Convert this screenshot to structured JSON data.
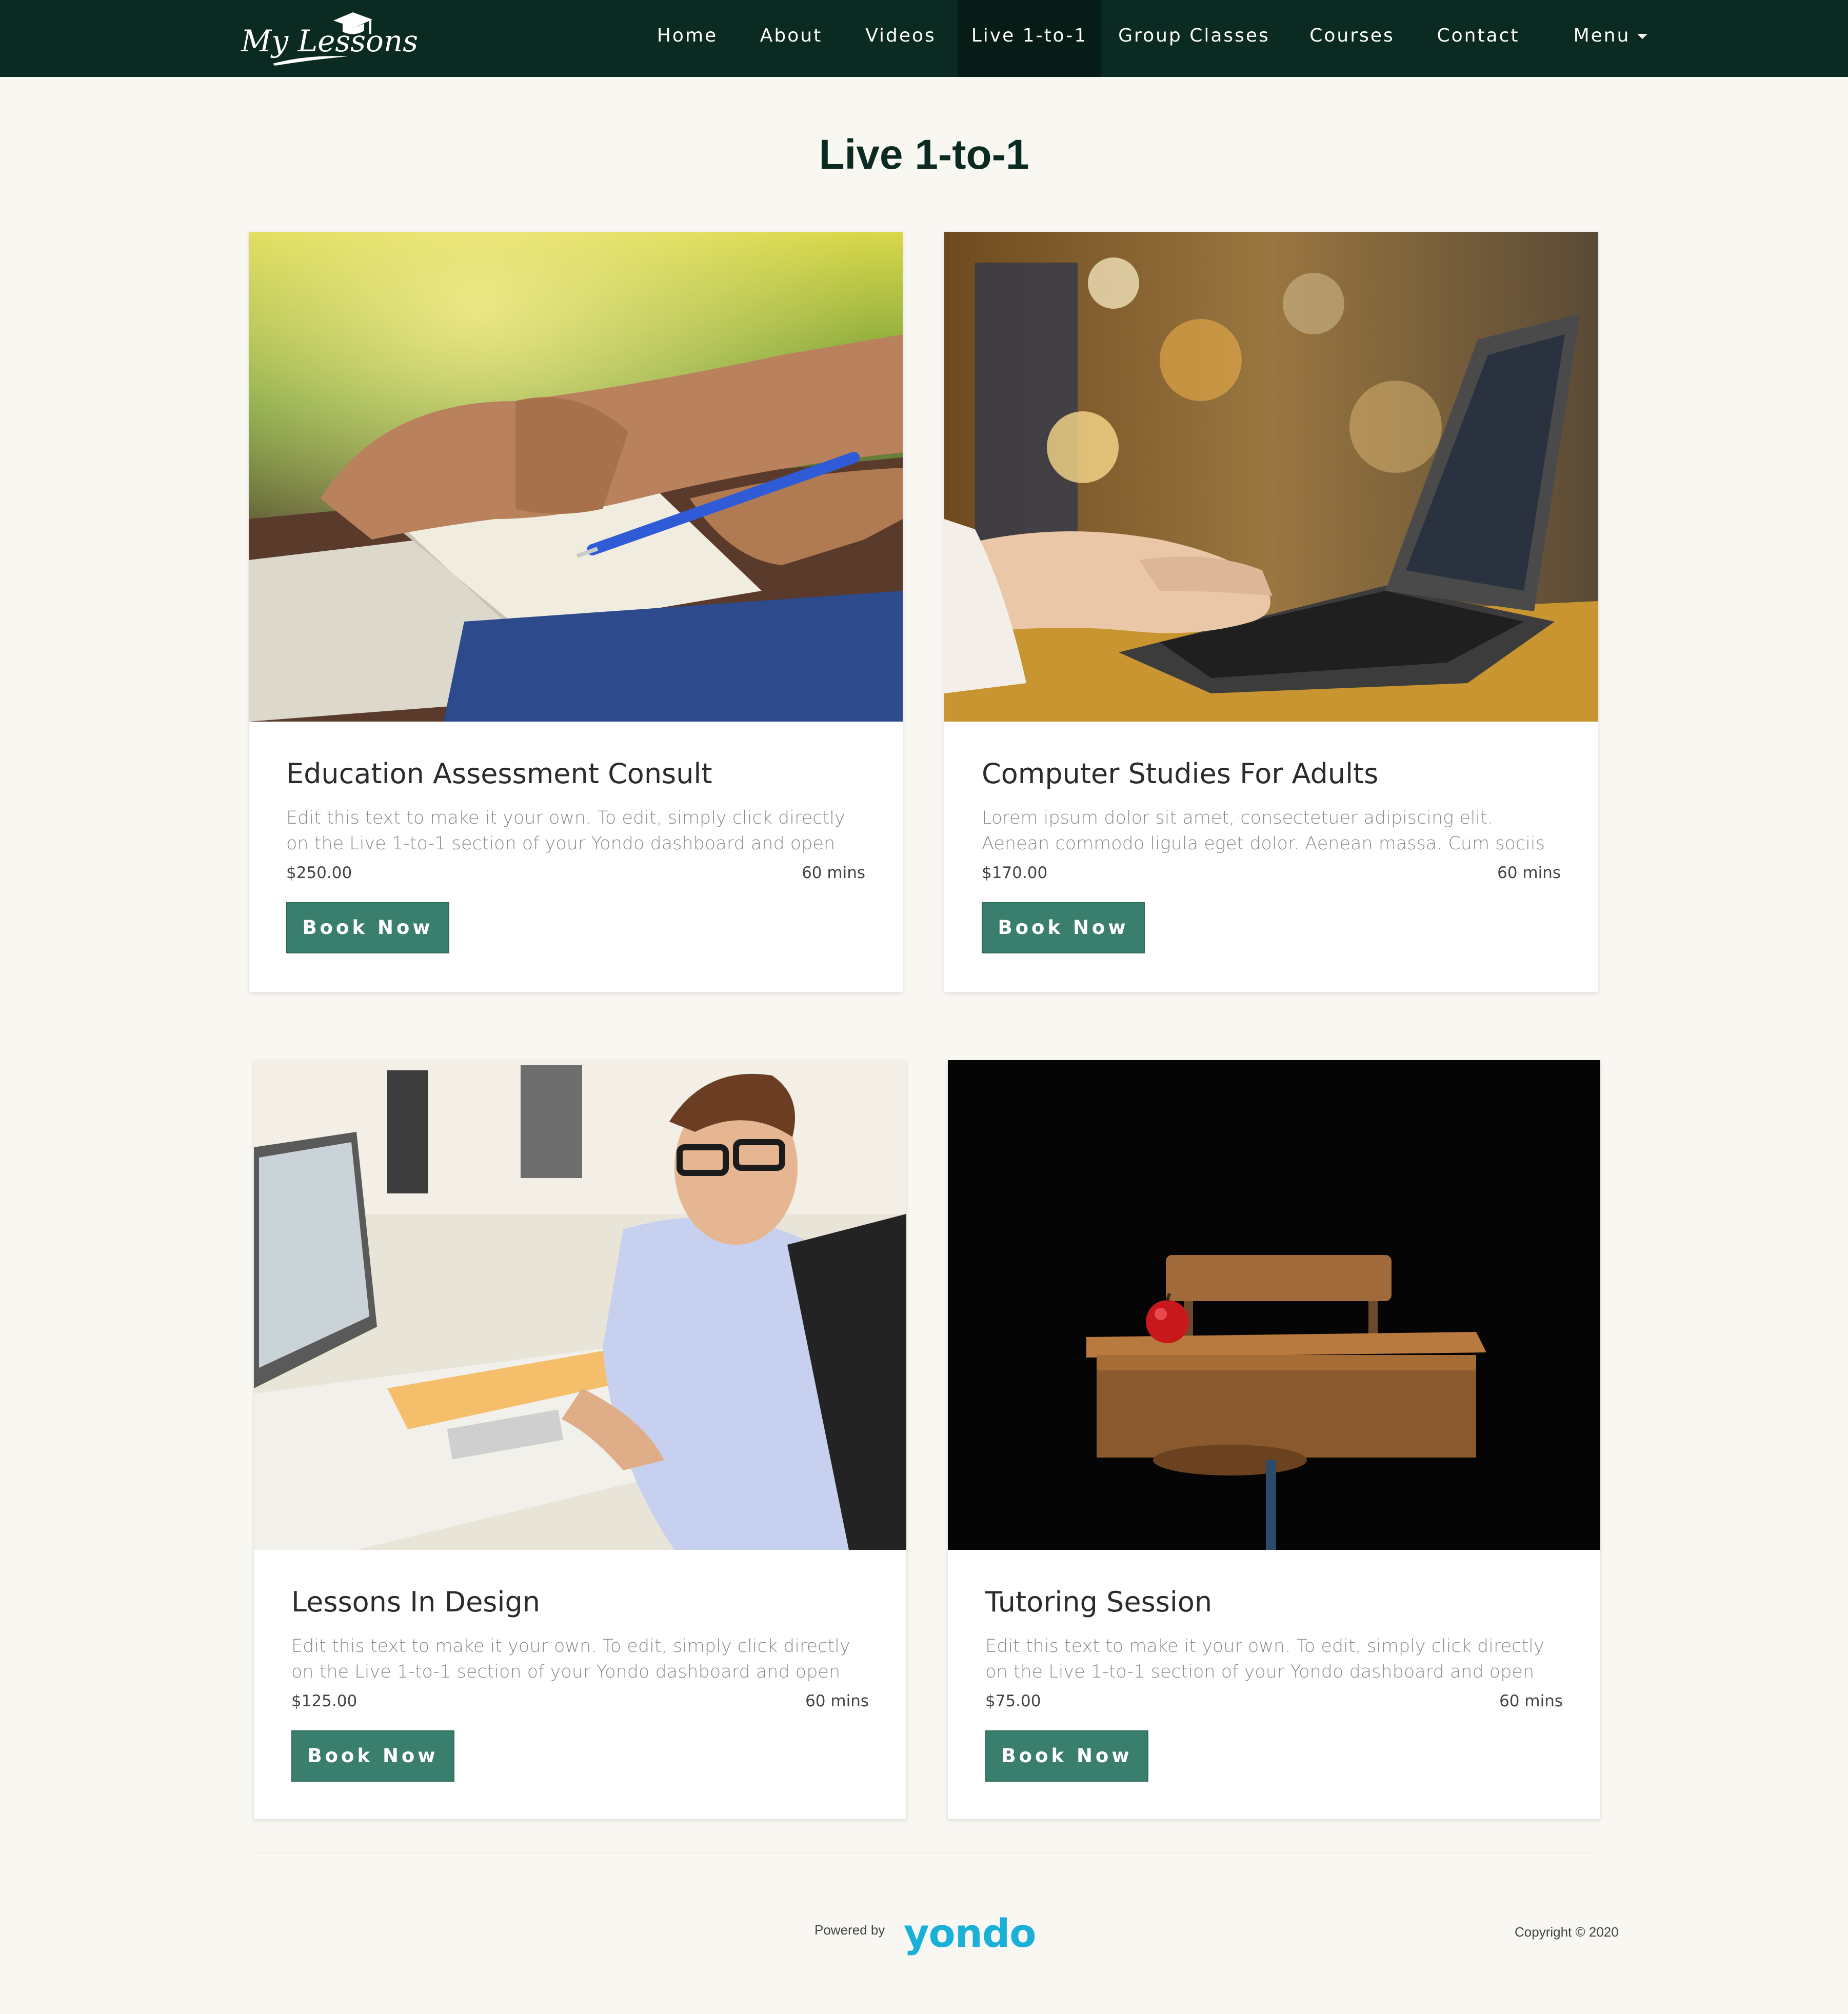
{
  "nav": {
    "logo_text": "My Lessons",
    "items": [
      {
        "label": "Home"
      },
      {
        "label": "About"
      },
      {
        "label": "Videos"
      },
      {
        "label": "Live 1-to-1"
      },
      {
        "label": "Group Classes"
      },
      {
        "label": "Courses"
      },
      {
        "label": "Contact"
      },
      {
        "label": "Menu"
      }
    ],
    "active_item": "Live 1-to-1"
  },
  "page": {
    "title": "Live 1-to-1"
  },
  "cards": [
    {
      "title": "Education Assessment Consult",
      "description": "Edit this text to make it your own. To edit, simply click directly on the Live 1-to-1 section of your Yondo dashboard and open the session...",
      "price": "$250.00",
      "duration": "60 mins",
      "button": "Book Now",
      "image": "student-writing-in-notebook"
    },
    {
      "title": "Computer Studies For Adults",
      "description": "Lorem ipsum dolor sit amet, consectetuer adipiscing elit. Aenean commodo ligula eget dolor. Aenean massa. Cum sociis natoque...",
      "price": "$170.00",
      "duration": "60 mins",
      "button": "Book Now",
      "image": "hands-typing-on-laptop"
    },
    {
      "title": "Lessons In Design",
      "description": "Edit this text to make it your own. To edit, simply click directly on the Live 1-to-1 section of your Yondo dashboard and open the session...",
      "price": "$125.00",
      "duration": "60 mins",
      "button": "Book Now",
      "image": "man-with-glasses-at-office-desk"
    },
    {
      "title": "Tutoring Session",
      "description": "Edit this text to make it your own. To edit, simply click directly on the Live 1-to-1 section of your Yondo dashboard and open the session...",
      "price": "$75.00",
      "duration": "60 mins",
      "button": "Book Now",
      "image": "school-desk-with-apple"
    }
  ],
  "footer": {
    "powered_by": "Powered by",
    "brand": "yondo",
    "copyright": "Copyright © 2020"
  },
  "colors": {
    "nav_bg": "#0b2a22",
    "page_bg": "#f9f7f2",
    "button": "#3a7f6d",
    "brand": "#1ab0d8"
  }
}
